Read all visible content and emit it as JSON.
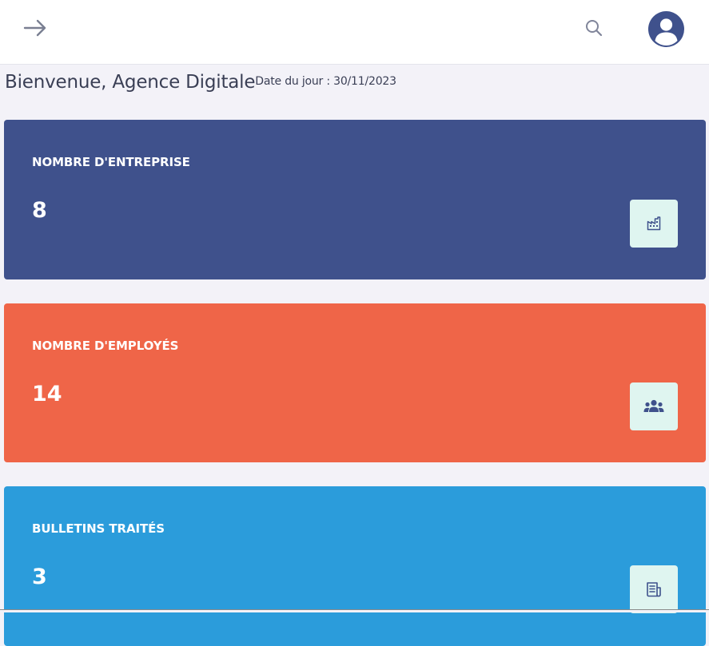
{
  "topbar": {
    "toggle_icon": "arrow-right-icon",
    "search_icon": "search-icon",
    "avatar_icon": "user-circle-icon"
  },
  "welcome": {
    "title": "Bienvenue, Agence Digitale",
    "date": "Date du jour : 30/11/2023"
  },
  "cards": [
    {
      "label": "NOMBRE D'ENTREPRISE",
      "value": "8",
      "color": "#3f518c",
      "icon": "factory-icon"
    },
    {
      "label": "NOMBRE D'EMPLOYÉS",
      "value": "14",
      "color": "#ef6548",
      "icon": "users-icon"
    },
    {
      "label": "BULLETINS TRAITÉS",
      "value": "3",
      "color": "#2b9cdb",
      "icon": "newspaper-icon"
    }
  ],
  "colors": {
    "background": "#f3f2f8",
    "icon_tile": "#dff5f0",
    "icon_ink": "#3f518c"
  }
}
